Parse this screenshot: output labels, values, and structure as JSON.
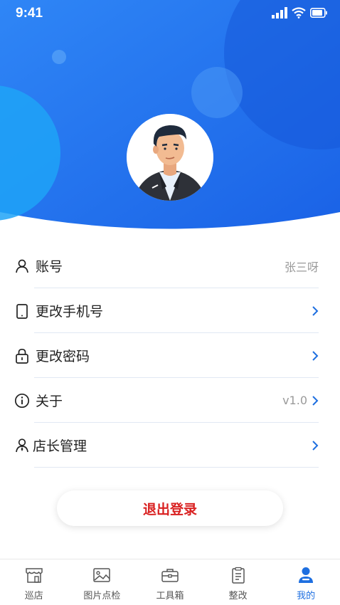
{
  "status_bar": {
    "time": "9:41"
  },
  "profile": {
    "avatar_icon": "user-avatar"
  },
  "menu": {
    "items": [
      {
        "label": "账号",
        "value": "张三呀",
        "icon": "user-icon",
        "chevron": false
      },
      {
        "label": "更改手机号",
        "value": "",
        "icon": "phone-icon",
        "chevron": true
      },
      {
        "label": "更改密码",
        "value": "",
        "icon": "lock-icon",
        "chevron": true
      },
      {
        "label": "关于",
        "value": "v1.0",
        "icon": "info-icon",
        "chevron": true
      },
      {
        "label": "店长管理",
        "value": "",
        "icon": "manager-icon",
        "chevron": true
      }
    ]
  },
  "logout": {
    "label": "退出登录"
  },
  "tabbar": {
    "items": [
      {
        "label": "巡店",
        "icon": "store-icon",
        "active": false
      },
      {
        "label": "图片点检",
        "icon": "image-icon",
        "active": false
      },
      {
        "label": "工具箱",
        "icon": "toolbox-icon",
        "active": false
      },
      {
        "label": "整改",
        "icon": "clipboard-icon",
        "active": false
      },
      {
        "label": "我的",
        "icon": "profile-icon",
        "active": true
      }
    ]
  },
  "colors": {
    "primary": "#1e6fe0",
    "logout": "#d92020",
    "divider": "#e1e8f3"
  }
}
